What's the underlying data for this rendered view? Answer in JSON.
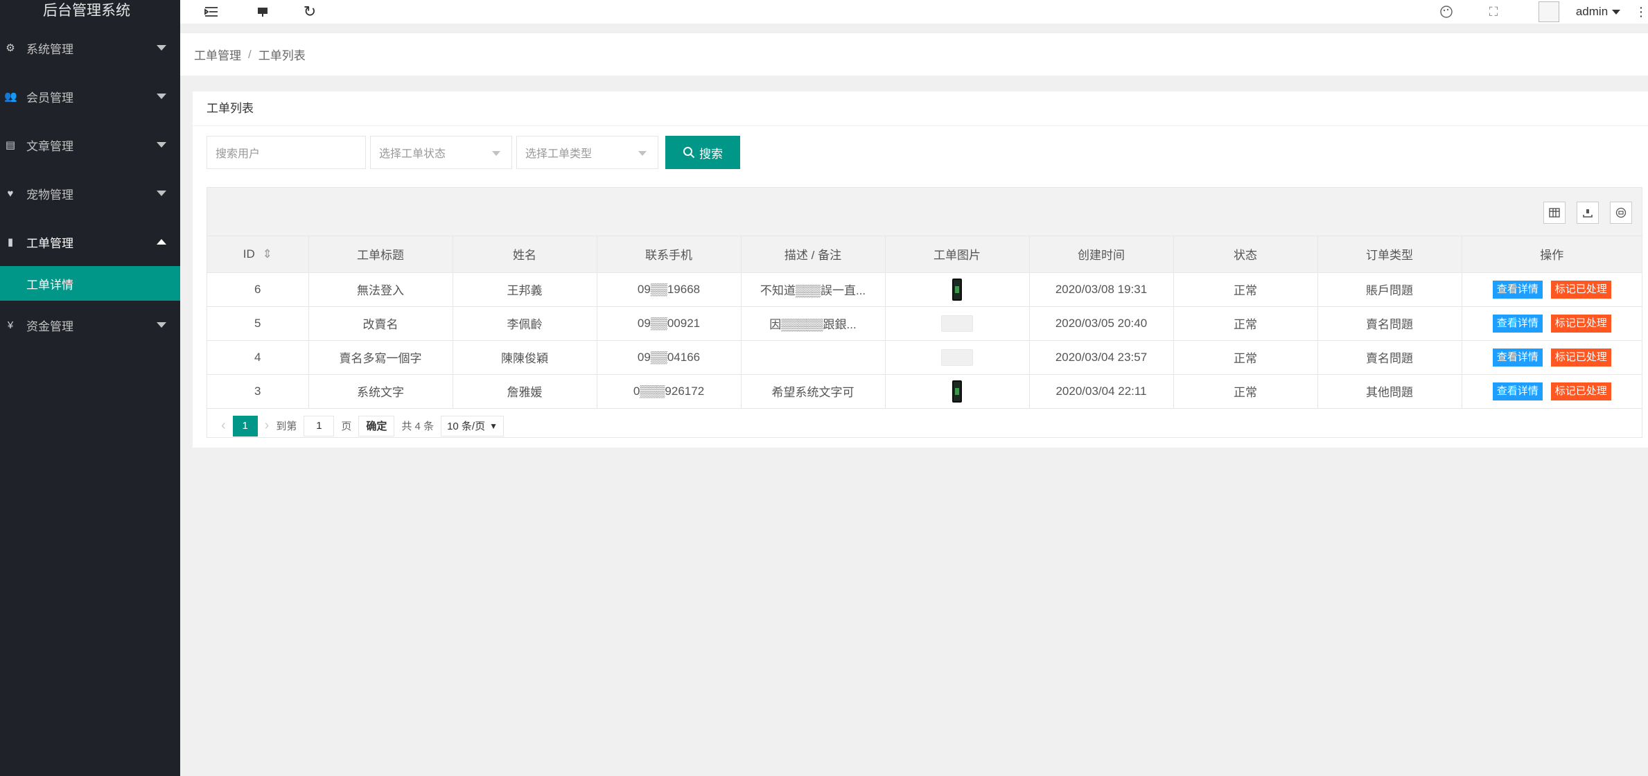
{
  "app": {
    "title": "后台管理系统"
  },
  "sidebar": {
    "items": [
      {
        "label": "系统管理",
        "icon": "gear-icon"
      },
      {
        "label": "会员管理",
        "icon": "users-icon"
      },
      {
        "label": "文章管理",
        "icon": "document-icon"
      },
      {
        "label": "宠物管理",
        "icon": "heart-icon"
      },
      {
        "label": "工单管理",
        "icon": "file-icon"
      },
      {
        "label": "资金管理",
        "icon": "yen-icon"
      }
    ],
    "active_sub": "工单详情"
  },
  "header": {
    "user": "admin"
  },
  "breadcrumb": {
    "parent": "工单管理",
    "separator": "/",
    "current": "工单列表"
  },
  "card": {
    "title": "工单列表"
  },
  "search": {
    "user_placeholder": "搜索用户",
    "status_placeholder": "选择工单状态",
    "type_placeholder": "选择工单类型",
    "button": "搜索"
  },
  "table": {
    "columns": [
      "ID",
      "工单标题",
      "姓名",
      "联系手机",
      "描述 / 备注",
      "工单图片",
      "创建时间",
      "状态",
      "订单类型",
      "操作"
    ],
    "rows": [
      {
        "id": "6",
        "title": "無法登入",
        "name": "王邦義",
        "phone": "09▒▒19668",
        "desc": "不知道▒▒▒誤一直...",
        "img": "phone",
        "created": "2020/03/08 19:31",
        "status": "正常",
        "type": "賬戶問題"
      },
      {
        "id": "5",
        "title": "改賣名",
        "name": "李佩齡",
        "phone": "09▒▒00921",
        "desc": "因▒▒▒▒▒跟銀...",
        "img": "placeholder",
        "created": "2020/03/05 20:40",
        "status": "正常",
        "type": "賣名問題"
      },
      {
        "id": "4",
        "title": "賣名多寫一個字",
        "name": "陳陳俊穎",
        "phone": "09▒▒04166",
        "desc": "",
        "img": "placeholder",
        "created": "2020/03/04 23:57",
        "status": "正常",
        "type": "賣名問題"
      },
      {
        "id": "3",
        "title": "系统文字",
        "name": "詹雅媛",
        "phone": "0▒▒▒926172",
        "desc": "希望系统文字可",
        "img": "phone",
        "created": "2020/03/04 22:11",
        "status": "正常",
        "type": "其他問題"
      }
    ],
    "view_btn": "查看详情",
    "mark_btn": "标记已处理"
  },
  "pager": {
    "current": "1",
    "goto_label": "到第",
    "page_input": "1",
    "page_unit": "页",
    "confirm": "确定",
    "total": "共 4 条",
    "page_size": "10 条/页"
  },
  "colors": {
    "sidebar_bg": "#20222a",
    "accent": "#009688",
    "blue": "#1e9fff",
    "orange": "#ff5722"
  }
}
